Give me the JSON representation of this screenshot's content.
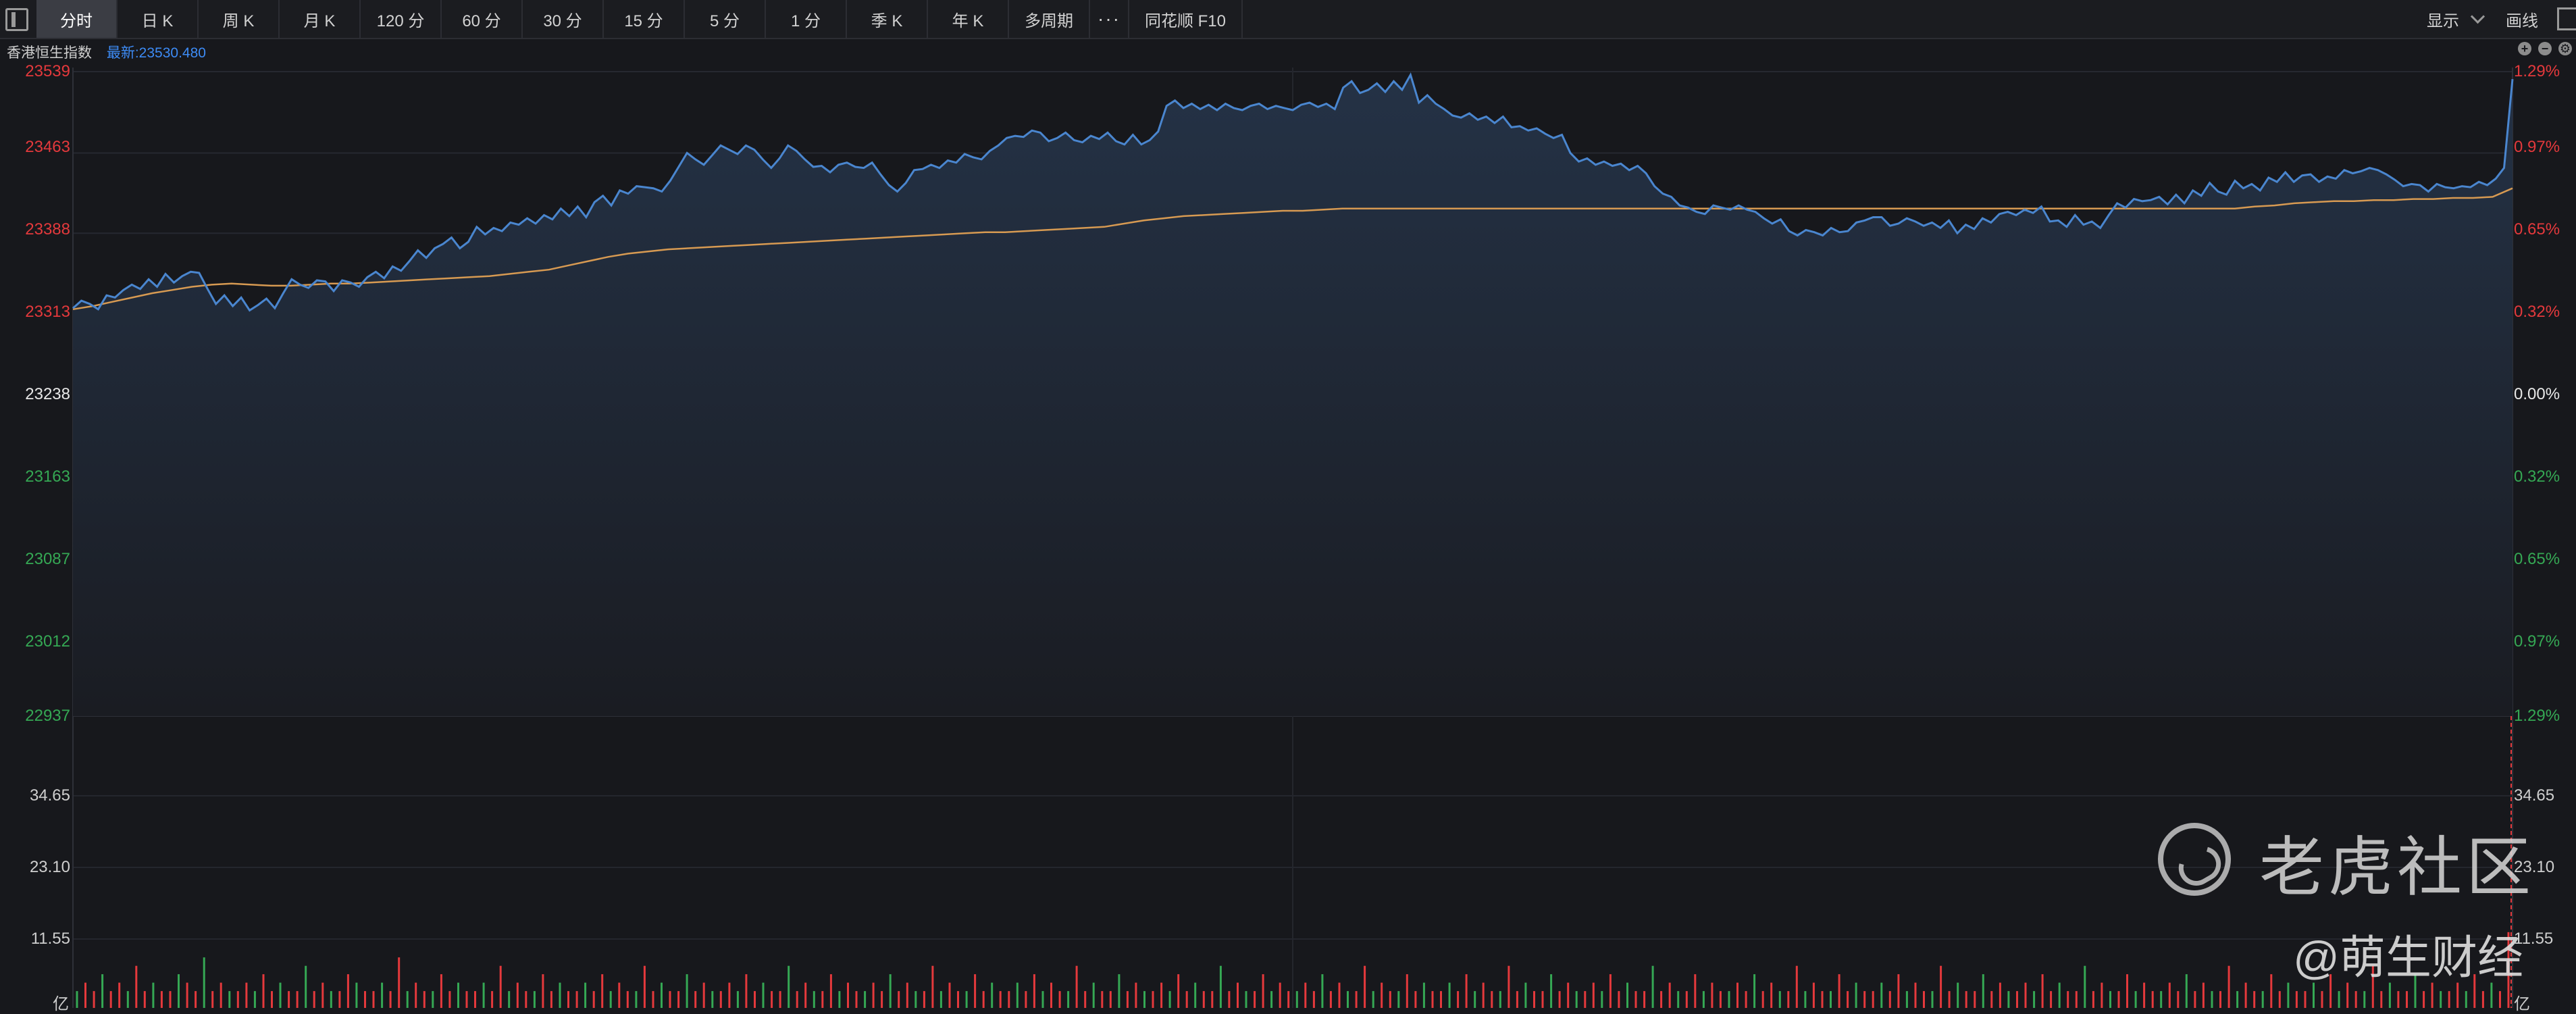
{
  "toolbar": {
    "tabs": [
      "分时",
      "日 K",
      "周 K",
      "月 K",
      "120 分",
      "60 分",
      "30 分",
      "15 分",
      "5 分",
      "1 分",
      "季 K",
      "年 K",
      "多周期",
      "···",
      "同花顺 F10"
    ],
    "active_tab": "分时",
    "display_label": "显示",
    "draw_label": "画线"
  },
  "header": {
    "index_name": "香港恒生指数",
    "latest_text": "最新:23530.480"
  },
  "left_axis": [
    "23539",
    "23463",
    "23388",
    "23313",
    "23238",
    "23163",
    "23087",
    "23012",
    "22937"
  ],
  "right_axis": [
    "1.29%",
    "0.97%",
    "0.65%",
    "0.32%",
    "0.00%",
    "0.32%",
    "0.65%",
    "0.97%",
    "1.29%"
  ],
  "volume_axis": [
    "34.65",
    "23.10",
    "11.55",
    "亿"
  ],
  "colors": {
    "price_line": "#4a86cf",
    "avg_line": "#d79a52",
    "up": "#e4393c",
    "down": "#35a854",
    "latest": "#3d8bf5"
  },
  "watermark": {
    "brand": "老虎社区",
    "author": "@萌生财经"
  },
  "chart_data": {
    "type": "line",
    "title": "香港恒生指数",
    "xlabel": "",
    "ylabel": "",
    "prev_close": 23238,
    "ylim": [
      22937,
      23539
    ],
    "volume_ylim": [
      0,
      34.65
    ],
    "series": [
      {
        "name": "",
        "values": [
          23318,
          23325,
          23322,
          23317,
          23330,
          23328,
          23335,
          23340,
          23336,
          23345,
          23338,
          23350,
          23342,
          23348,
          23352,
          23351,
          23336,
          23322,
          23330,
          23320,
          23328,
          23316,
          23321,
          23327,
          23318,
          23332,
          23345,
          23340,
          23337,
          23344,
          23343,
          23334,
          23344,
          23342,
          23338,
          23347,
          23352,
          23346,
          23357,
          23353,
          23362,
          23372,
          23365,
          23374,
          23378,
          23384,
          23374,
          23380,
          23394,
          23387,
          23393,
          23390,
          23398,
          23396,
          23402,
          23397,
          23405,
          23401,
          23411,
          23404,
          23413,
          23403,
          23417,
          23423,
          23414,
          23428,
          23425,
          23432,
          23431,
          23430,
          23427,
          23437,
          23450,
          23463,
          23457,
          23452,
          23461,
          23470,
          23466,
          23462,
          23470,
          23466,
          23457,
          23449,
          23458,
          23470,
          23465,
          23457,
          23450,
          23451,
          23445,
          23452,
          23454,
          23450,
          23449,
          23454,
          23443,
          23433,
          23427,
          23435,
          23447,
          23448,
          23452,
          23449,
          23456,
          23454,
          23462,
          23459,
          23457,
          23465,
          23470,
          23477,
          23479,
          23478,
          23484,
          23482,
          23474,
          23477,
          23482,
          23475,
          23473,
          23479,
          23476,
          23482,
          23474,
          23471,
          23480,
          23471,
          23475,
          23483,
          23507,
          23512,
          23505,
          23509,
          23504,
          23508,
          23503,
          23509,
          23505,
          23503,
          23507,
          23509,
          23504,
          23507,
          23505,
          23503,
          23508,
          23510,
          23506,
          23509,
          23504,
          23524,
          23530,
          23519,
          23522,
          23528,
          23520,
          23530,
          23522,
          23536,
          23510,
          23517,
          23509,
          23504,
          23498,
          23496,
          23500,
          23494,
          23497,
          23491,
          23497,
          23487,
          23488,
          23484,
          23486,
          23481,
          23477,
          23480,
          23463,
          23455,
          23458,
          23452,
          23455,
          23451,
          23453,
          23447,
          23451,
          23444,
          23432,
          23425,
          23422,
          23414,
          23412,
          23408,
          23406,
          23414,
          23412,
          23410,
          23414,
          23410,
          23408,
          23402,
          23397,
          23401,
          23390,
          23386,
          23391,
          23389,
          23386,
          23393,
          23389,
          23390,
          23398,
          23400,
          23403,
          23403,
          23395,
          23397,
          23402,
          23399,
          23395,
          23398,
          23393,
          23400,
          23388,
          23396,
          23392,
          23402,
          23398,
          23406,
          23408,
          23405,
          23410,
          23407,
          23413,
          23399,
          23400,
          23394,
          23405,
          23396,
          23399,
          23393,
          23405,
          23416,
          23412,
          23420,
          23418,
          23419,
          23422,
          23415,
          23424,
          23416,
          23428,
          23423,
          23435,
          23427,
          23424,
          23437,
          23430,
          23434,
          23428,
          23440,
          23436,
          23445,
          23436,
          23442,
          23443,
          23436,
          23441,
          23439,
          23447,
          23444,
          23446,
          23449,
          23447,
          23443,
          23438,
          23432,
          23434,
          23433,
          23427,
          23434,
          23431,
          23430,
          23432,
          23431,
          23436,
          23433,
          23439,
          23449,
          23532
        ]
      },
      {
        "name": "",
        "values": [
          23317,
          23320,
          23324,
          23328,
          23332,
          23335,
          23338,
          23340,
          23341,
          23340,
          23339,
          23339,
          23340,
          23341,
          23341,
          23342,
          23343,
          23344,
          23345,
          23346,
          23347,
          23348,
          23350,
          23352,
          23354,
          23358,
          23362,
          23366,
          23369,
          23371,
          23373,
          23374,
          23375,
          23376,
          23377,
          23378,
          23379,
          23380,
          23381,
          23382,
          23383,
          23384,
          23385,
          23386,
          23387,
          23388,
          23389,
          23389,
          23390,
          23391,
          23392,
          23393,
          23394,
          23397,
          23400,
          23402,
          23404,
          23405,
          23406,
          23407,
          23408,
          23409,
          23409,
          23410,
          23411,
          23411,
          23411,
          23411,
          23411,
          23411,
          23411,
          23411,
          23411,
          23411,
          23411,
          23411,
          23411,
          23411,
          23411,
          23411,
          23411,
          23411,
          23411,
          23411,
          23411,
          23411,
          23411,
          23411,
          23411,
          23411,
          23411,
          23411,
          23411,
          23411,
          23411,
          23411,
          23411,
          23411,
          23411,
          23411,
          23411,
          23411,
          23411,
          23411,
          23411,
          23411,
          23411,
          23411,
          23411,
          23411,
          23413,
          23414,
          23416,
          23417,
          23418,
          23418,
          23419,
          23419,
          23420,
          23420,
          23421,
          23421,
          23422,
          23430
        ]
      }
    ],
    "volume": [
      2,
      3,
      2,
      4,
      2,
      3,
      2,
      5,
      2,
      3,
      2,
      2,
      4,
      3,
      2,
      6,
      2,
      3,
      2,
      2,
      3,
      2,
      4,
      2,
      3,
      2,
      2,
      5,
      2,
      3,
      2,
      2,
      4,
      3,
      2,
      2,
      3,
      2,
      6,
      2,
      3,
      2,
      2,
      4,
      2,
      3,
      2,
      2,
      3,
      2,
      5,
      2,
      3,
      2,
      2,
      4,
      2,
      3,
      2,
      2,
      3,
      2,
      4,
      2,
      3,
      2,
      2,
      5,
      2,
      3,
      2,
      2,
      4,
      2,
      3,
      2,
      2,
      3,
      2,
      4,
      2,
      3,
      2,
      2,
      5,
      2,
      3,
      2,
      2,
      4,
      2,
      3,
      2,
      2,
      3,
      2,
      4,
      2,
      3,
      2,
      2,
      5,
      2,
      3,
      2,
      2,
      4,
      2,
      3,
      2,
      2,
      3,
      2,
      4,
      2,
      3,
      2,
      2,
      5,
      2,
      3,
      2,
      2,
      4,
      2,
      3,
      2,
      2,
      3,
      2,
      4,
      2,
      3,
      2,
      2,
      5,
      2,
      3,
      2,
      2,
      4,
      2,
      3,
      2,
      2,
      3,
      2,
      4,
      2,
      3,
      2,
      2,
      5,
      2,
      3,
      2,
      2,
      4,
      2,
      3,
      2,
      2,
      3,
      2,
      4,
      2,
      3,
      2,
      2,
      5,
      2,
      3,
      2,
      2,
      4,
      2,
      3,
      2,
      2,
      3,
      2,
      4,
      2,
      3,
      2,
      2,
      5,
      2,
      3,
      2,
      2,
      4,
      2,
      3,
      2,
      2,
      3,
      2,
      4,
      2,
      3,
      2,
      2,
      5,
      2,
      3,
      2,
      2,
      4,
      2,
      3,
      2,
      2,
      3,
      2,
      4,
      2,
      3,
      2,
      2,
      5,
      2,
      3,
      2,
      2,
      4,
      2,
      3,
      2,
      2,
      3,
      2,
      4,
      2,
      3,
      2,
      2,
      5,
      2,
      3,
      2,
      2,
      4,
      2,
      3,
      2,
      2,
      3,
      2,
      4,
      2,
      3,
      2,
      2,
      5,
      2,
      3,
      2,
      2,
      4,
      2,
      3,
      2,
      2,
      3,
      2,
      4,
      2,
      3,
      2,
      2,
      5,
      2,
      3,
      2,
      2,
      4,
      2,
      3,
      2,
      2,
      3,
      2,
      4,
      2,
      3,
      2,
      9
    ]
  }
}
